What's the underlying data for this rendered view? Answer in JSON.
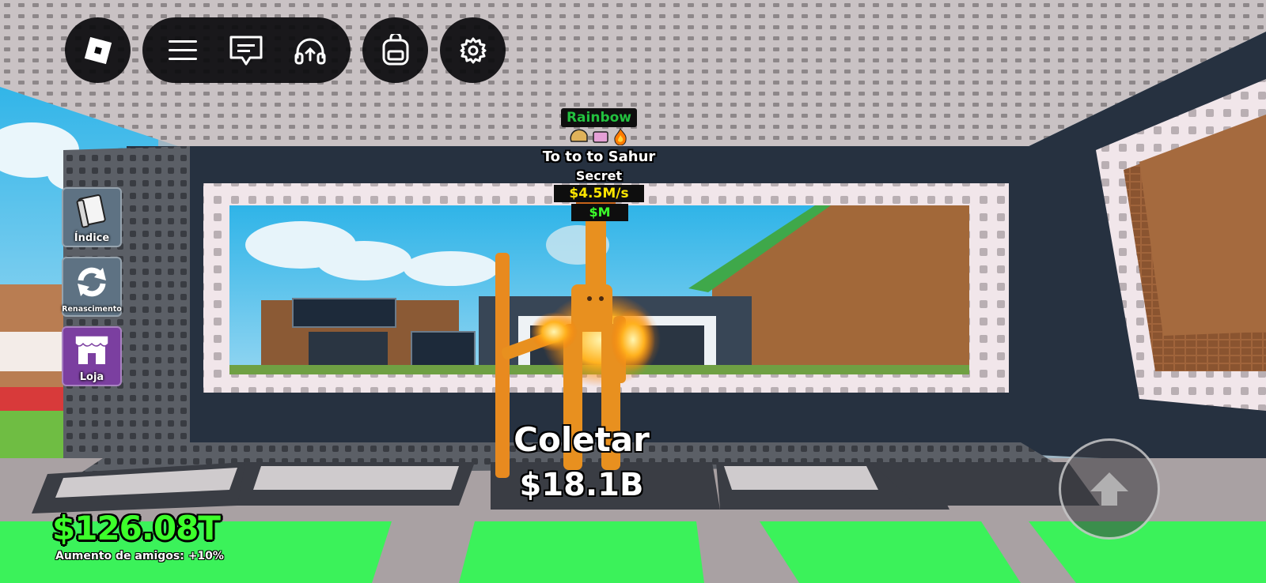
{
  "topbar": {
    "home_icon": "roblox-logo-icon",
    "menu_icon": "hamburger-menu-icon",
    "chat_icon": "chat-icon",
    "voice_icon": "headphones-icon",
    "backpack_icon": "backpack-icon",
    "settings_icon": "gear-icon"
  },
  "side_menu": {
    "items": [
      {
        "label": "Índice",
        "icon": "book-icon",
        "color": "#5e7283"
      },
      {
        "label": "Renascimento",
        "icon": "refresh-icon",
        "color": "#5e7283"
      },
      {
        "label": "Loja",
        "icon": "shop-icon",
        "color": "#7b3fa0"
      }
    ]
  },
  "billboard": {
    "mutation": "Rainbow",
    "trait_icons": [
      "taco-icon",
      "tv-icon",
      "fire-icon"
    ],
    "name": "To to to Sahur",
    "rarity": "Secret",
    "rate": "$4.5M/s",
    "price": "$M"
  },
  "collect": {
    "label": "Coletar",
    "amount": "$18.1B"
  },
  "wallet": {
    "money": "$126.08T",
    "friends_boost": "Aumento de amigos: +10%"
  },
  "jump_icon": "up-arrow-icon",
  "colors": {
    "money_green": "#3cff2a",
    "mutation_green": "#23c13f",
    "rate_yellow": "#ffe600",
    "hud_black": "#0a0a0c",
    "shop_purple": "#7b3fa0"
  }
}
